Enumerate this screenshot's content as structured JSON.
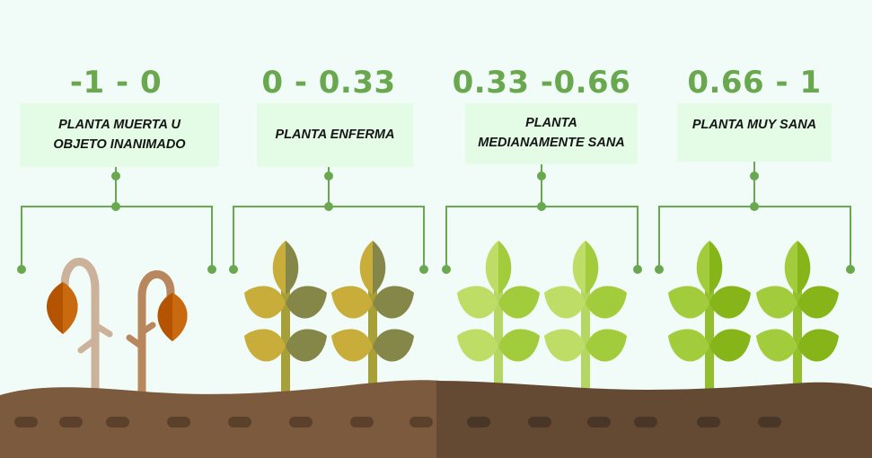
{
  "categories": [
    {
      "range": "-1 - 0",
      "label": "PLANTA MUERTA U OBJETO INANIMADO",
      "state": "dead"
    },
    {
      "range": "0 - 0.33",
      "label": "PLANTA ENFERMA",
      "state": "sick"
    },
    {
      "range": "0.33 -0.66",
      "label": "PLANTA MEDIANAMENTE SANA",
      "state": "moderate"
    },
    {
      "range": "0.66 - 1",
      "label": "PLANTA MUY SANA",
      "state": "healthy"
    }
  ],
  "colors": {
    "background": "#f1fbf7",
    "accent_green": "#6aa84f",
    "label_box": "#e4fbe6",
    "soil_light": "#7b5a3d",
    "soil_dark": "#654a33",
    "soil_dash_light": "#5b412c",
    "soil_dash_dark": "#4a3626"
  }
}
